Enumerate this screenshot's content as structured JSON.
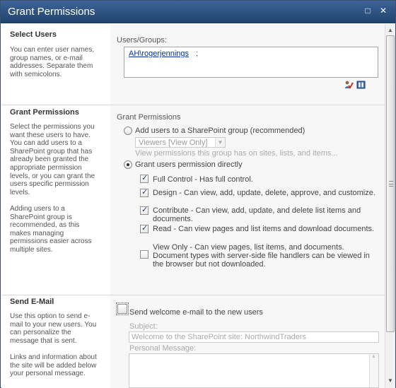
{
  "window": {
    "title": "Grant Permissions",
    "maximize_glyph": "□",
    "close_glyph": "✕"
  },
  "select_users": {
    "heading": "Select Users",
    "description": "You can enter user names, group names, or e-mail addresses. Separate them with semicolons.",
    "field_label": "Users/Groups:",
    "resolved_user": "AH\\rogerjennings",
    "separator": ";",
    "check_names_icon": "check-names-icon",
    "browse_icon": "address-book-icon"
  },
  "grant_permissions": {
    "heading": "Grant Permissions",
    "description_1": "Select the permissions you want these users to have. You can add users to a SharePoint group that has already been granted the appropriate permission levels, or you can grant the users specific permission levels.",
    "description_2": "Adding users to a SharePoint group is recommended, as this makes managing permissions easier across multiple sites.",
    "group_label": "Grant Permissions",
    "option_group": "Add users to a SharePoint group (recommended)",
    "group_select_value": "Viewers [View Only]",
    "group_hint": "View permissions this group has on sites, lists, and items...",
    "option_direct": "Grant users permission directly",
    "permissions": [
      {
        "text": "Full Control - Has full control.",
        "checked": true
      },
      {
        "text": "Design - Can view, add, update, delete, approve, and customize.",
        "checked": true
      },
      {
        "text": "Contribute - Can view, add, update, and delete list items and documents.",
        "checked": true
      },
      {
        "text": "Read - Can view pages and list items and download documents.",
        "checked": true
      },
      {
        "text": "View Only - Can view pages, list items, and documents. Document types with server-side file handlers can be viewed in the browser but not downloaded.",
        "checked": false
      }
    ]
  },
  "send_email": {
    "heading": "Send E-Mail",
    "description_1": "Use this option to send e-mail to your new users. You can personalize the message that is sent.",
    "description_2": "Links and information about the site will be added below your personal message.",
    "checkbox_label": "Send welcome e-mail to the new users",
    "subject_label": "Subject:",
    "subject_value": "Welcome to the SharePoint site: NorthwindTraders",
    "message_label": "Personal Message:"
  },
  "colors": {
    "title_bar": "#2b5080",
    "section_bg": "#f7f7f7",
    "link": "#003399"
  }
}
